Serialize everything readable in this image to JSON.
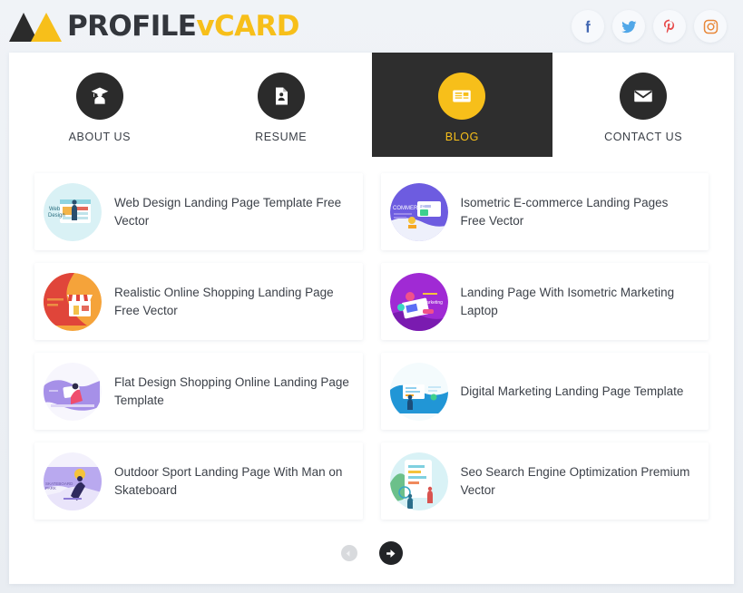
{
  "header": {
    "logo": {
      "icon": "mountain-triangles-logo",
      "text_primary": "PROFILE",
      "text_accent": "vCARD"
    },
    "socials": [
      {
        "name": "facebook-icon",
        "label": "Facebook",
        "color": "#4267b2"
      },
      {
        "name": "twitter-icon",
        "label": "Twitter",
        "color": "#51a7e8"
      },
      {
        "name": "pinterest-icon",
        "label": "Pinterest",
        "color": "#e74c4c"
      },
      {
        "name": "instagram-icon",
        "label": "Instagram",
        "color": "#e8883a"
      }
    ]
  },
  "nav": {
    "items": [
      {
        "label": "ABOUT US",
        "icon": "graduation-user-icon",
        "active": false
      },
      {
        "label": "RESUME",
        "icon": "document-person-icon",
        "active": false
      },
      {
        "label": "BLOG",
        "icon": "newspaper-icon",
        "active": true
      },
      {
        "label": "CONTACT US",
        "icon": "envelope-icon",
        "active": false
      }
    ]
  },
  "blog": {
    "posts": [
      {
        "title": "Web Design Landing Page Template Free Vector",
        "thumb": "web-design-thumb"
      },
      {
        "title": "Isometric E-commerce Landing Pages Free Vector",
        "thumb": "ecommerce-thumb"
      },
      {
        "title": "Realistic Online Shopping Landing Page Free Vector",
        "thumb": "online-shopping-thumb"
      },
      {
        "title": "Landing Page With Isometric Marketing Laptop",
        "thumb": "marketing-laptop-thumb"
      },
      {
        "title": "Flat Design Shopping Online Landing Page Template",
        "thumb": "flat-shopping-thumb"
      },
      {
        "title": "Digital Marketing Landing Page Template",
        "thumb": "digital-marketing-thumb"
      },
      {
        "title": "Outdoor Sport Landing Page With Man on Skateboard",
        "thumb": "skateboard-thumb"
      },
      {
        "title": "Seo Search Engine Optimization Premium Vector",
        "thumb": "seo-thumb"
      }
    ]
  },
  "pagination": {
    "prev": {
      "name": "previous-page-button",
      "enabled": false
    },
    "next": {
      "name": "next-page-button",
      "enabled": true
    }
  },
  "colors": {
    "accent": "#f7bf1a",
    "dark": "#2b2b2b",
    "text": "#3c4149",
    "page_bg": "#eef1f6"
  }
}
